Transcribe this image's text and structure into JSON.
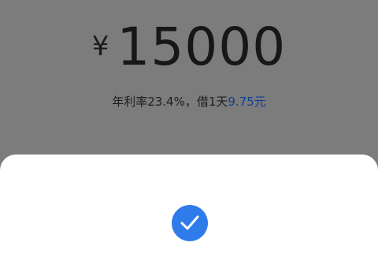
{
  "loan": {
    "currency_symbol": "¥",
    "amount": "15000",
    "rate_text": "年利率23.4%，借1天",
    "interest_text": "9.75元"
  },
  "sheet": {
    "status_icon": "check-icon"
  },
  "colors": {
    "overlay": "#7c7c7c",
    "accent": "#2f7bea",
    "interest": "#0f3d94"
  }
}
